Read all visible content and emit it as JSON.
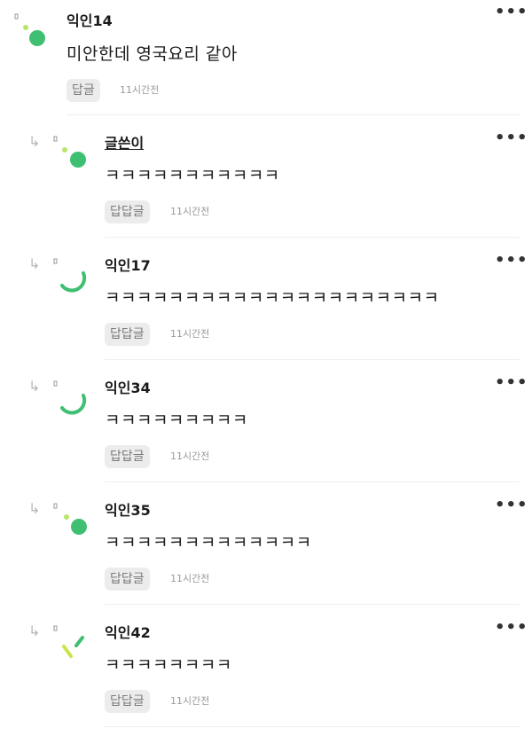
{
  "colors": {
    "accent_green": "#3fbf72",
    "accent_lime": "#b9e36b",
    "divider": "#eeeeee"
  },
  "comments": [
    {
      "author": "익인14",
      "body": "미안한데 영국요리 같아",
      "reply_label": "답글",
      "time": "11시간전",
      "more": "•••",
      "avatar_icon": "green-dot-avatar-icon"
    },
    {
      "author": "글쓴이",
      "body": "ㅋㅋㅋㅋㅋㅋㅋㅋㅋㅋㅋ",
      "reply_label": "답답글",
      "time": "11시간전",
      "more": "•••",
      "reply_icon": "reply-arrow-icon",
      "avatar_icon": "green-dot-avatar-icon"
    },
    {
      "author": "익인17",
      "body": "ㅋㅋㅋㅋㅋㅋㅋㅋㅋㅋㅋㅋㅋㅋㅋㅋㅋㅋㅋㅋㅋ",
      "reply_label": "답답글",
      "time": "11시간전",
      "more": "•••",
      "reply_icon": "reply-arrow-icon",
      "avatar_icon": "green-arc-avatar-icon"
    },
    {
      "author": "익인34",
      "body": "ㅋㅋㅋㅋㅋㅋㅋㅋㅋ",
      "reply_label": "답답글",
      "time": "11시간전",
      "more": "•••",
      "reply_icon": "reply-arrow-icon",
      "avatar_icon": "green-arc-avatar-icon"
    },
    {
      "author": "익인35",
      "body": "ㅋㅋㅋㅋㅋㅋㅋㅋㅋㅋㅋㅋㅋ",
      "reply_label": "답답글",
      "time": "11시간전",
      "more": "•••",
      "reply_icon": "reply-arrow-icon",
      "avatar_icon": "green-dot-avatar-icon"
    },
    {
      "author": "익인42",
      "body": "ㅋㅋㅋㅋㅋㅋㅋㅋ",
      "reply_label": "답답글",
      "time": "11시간전",
      "more": "•••",
      "reply_icon": "reply-arrow-icon",
      "avatar_icon": "lime-sticks-avatar-icon"
    }
  ]
}
